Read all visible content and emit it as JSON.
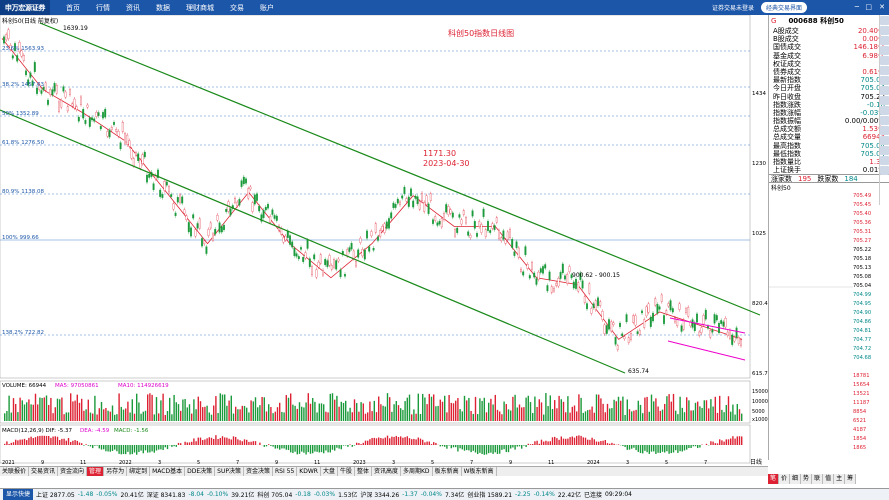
{
  "topbar": {
    "logo": "申万宏源证券",
    "menu": [
      "首页",
      "行情",
      "资讯",
      "数据",
      "理财商城",
      "交易",
      "账户"
    ],
    "login_links": "证券交易未登录",
    "classic_btn": "经典交易界面",
    "controls": [
      "─",
      "□",
      "✕"
    ]
  },
  "chart": {
    "price_label": "科创50(日线 前复权)",
    "title_text": "科创50指数日线图",
    "high_label": "1639.19",
    "low_label": "635.74",
    "annotation_price": "1171.30",
    "annotation_date": "2023-04-30",
    "range_label": "900.62 - 900.15",
    "fib_labels": [
      "23.6% 1563.93",
      "38.2% 1457.63",
      "50% 1352.89",
      "61.8% 1276.50",
      "80.9% 1138.08",
      "100% 999.66",
      "138.2% 722.82"
    ],
    "right_axis": [
      "1434",
      "1230",
      "1025",
      "820.4",
      "615.7"
    ],
    "volume_label": "VOLUME: 66944",
    "ma5_label": "MA5: 97050861",
    "ma10_label": "MA10: 114926619",
    "volume_axis": [
      "15000",
      "10000",
      "5000",
      "x10000"
    ],
    "macd_label": "MACD(12,26,9) DIF: -5.37",
    "dea_label": "DEA: -4.59",
    "macd_val_label": "MACD: -1.56",
    "date_labels": [
      "2021",
      "9",
      "11",
      "2022",
      "3",
      "5",
      "7",
      "9",
      "11",
      "2023",
      "3",
      "5",
      "7",
      "9",
      "11",
      "2024",
      "3",
      "5",
      "7"
    ],
    "period_label": "日线"
  },
  "chart_data": {
    "type": "line",
    "x_dates": [
      "2021-07",
      "2021-09",
      "2021-11",
      "2022-01",
      "2022-03",
      "2022-05",
      "2022-07",
      "2022-09",
      "2022-11",
      "2023-01",
      "2023-03",
      "2023-05",
      "2023-07",
      "2023-09",
      "2023-11",
      "2024-01",
      "2024-03",
      "2024-05",
      "2024-07"
    ],
    "series": [
      {
        "values": [
          1600,
          1450,
          1380,
          1300,
          1150,
          1000,
          1150,
          1000,
          900,
          1000,
          1140,
          1050,
          1050,
          900,
          880,
          720,
          800,
          760,
          720
        ]
      }
    ],
    "ylim": [
      615.7,
      1639.19
    ]
  },
  "right_panel": {
    "code": "000688",
    "name": "科创50",
    "rows": [
      {
        "k": "A股成交",
        "v": "20.40亿",
        "c": "up"
      },
      {
        "k": "B股成交",
        "v": "0.00亿",
        "c": "up"
      },
      {
        "k": "国债成交",
        "v": "146.18亿",
        "c": "up"
      },
      {
        "k": "基金成交",
        "v": "6.98亿",
        "c": "up"
      },
      {
        "k": "权证成交",
        "v": "",
        "c": "up"
      },
      {
        "k": "债券成交",
        "v": "0.61亿",
        "c": "up"
      },
      {
        "k": "最新指数",
        "v": "705.04",
        "c": "green"
      },
      {
        "k": "今日开盘",
        "v": "705.04",
        "c": "green"
      },
      {
        "k": "昨日收盘",
        "v": "705.22",
        "c": "black"
      },
      {
        "k": "指数涨跌",
        "v": "-0.18",
        "c": "green"
      },
      {
        "k": "指数涨幅",
        "v": "-0.03%",
        "c": "green"
      },
      {
        "k": "指数振幅",
        "v": "0.00/0.00%",
        "c": "black"
      },
      {
        "k": "总成交额",
        "v": "1.53亿",
        "c": "up"
      },
      {
        "k": "总成交量",
        "v": "66944",
        "c": "up"
      },
      {
        "k": "最高指数",
        "v": "705.04",
        "c": "green"
      },
      {
        "k": "最低指数",
        "v": "705.04",
        "c": "green"
      },
      {
        "k": "指数量比",
        "v": "1.33",
        "c": "up"
      },
      {
        "k": "上证换手",
        "v": "0.01%",
        "c": "black"
      }
    ],
    "up_label": "涨家数",
    "up_count": "195",
    "down_label": "跌家数",
    "down_count": "184",
    "sub_label": "科创50",
    "ticks": [
      "705.49",
      "705.45",
      "705.40",
      "705.36",
      "705.31",
      "705.27",
      "705.22",
      "705.18",
      "705.13",
      "705.08",
      "705.04",
      "704.99",
      "704.95",
      "704.90",
      "704.86",
      "704.81",
      "704.77",
      "704.72",
      "704.68"
    ],
    "volume_ticks": [
      "18781",
      "15654",
      "13521",
      "11187",
      "8854",
      "6521",
      "4187",
      "1854",
      "1865"
    ],
    "tabs": [
      "笔",
      "价",
      "细",
      "势",
      "联",
      "值",
      "主",
      "筹"
    ]
  },
  "tabs": [
    "关联报价",
    "交易资讯",
    "资金流向",
    "管理",
    "另存为",
    "绑定到",
    "MACD基本",
    "DDE决策",
    "SUP决策",
    "资金决策",
    "RSI 55",
    "KDWR",
    "大盘",
    "牛股",
    "整体",
    "资讯高度",
    "多周期KD",
    "板东新高",
    "W板东新高"
  ],
  "status": {
    "quick": "显示快捷",
    "items": [
      {
        "t": "上证 2877.05",
        "c": ""
      },
      {
        "t": "-1.48",
        "c": "dn"
      },
      {
        "t": "-0.05%",
        "c": "dn"
      },
      {
        "t": "20.41亿",
        "c": ""
      },
      {
        "t": "深证 8341.83",
        "c": ""
      },
      {
        "t": "-8.04",
        "c": "dn"
      },
      {
        "t": "-0.10%",
        "c": "dn"
      },
      {
        "t": "39.21亿",
        "c": ""
      },
      {
        "t": "科创 705.04",
        "c": ""
      },
      {
        "t": "-0.18",
        "c": "dn"
      },
      {
        "t": "-0.03%",
        "c": "dn"
      },
      {
        "t": "1.53亿",
        "c": ""
      },
      {
        "t": "沪深 3344.26",
        "c": ""
      },
      {
        "t": "-1.37",
        "c": "dn"
      },
      {
        "t": "-0.04%",
        "c": "dn"
      },
      {
        "t": "7.34亿",
        "c": ""
      },
      {
        "t": "创业指 1589.21",
        "c": ""
      },
      {
        "t": "-2.25",
        "c": "dn"
      },
      {
        "t": "-0.14%",
        "c": "dn"
      },
      {
        "t": "22.42亿",
        "c": ""
      },
      {
        "t": "已连接",
        "c": ""
      },
      {
        "t": "09:29:04",
        "c": ""
      }
    ]
  }
}
